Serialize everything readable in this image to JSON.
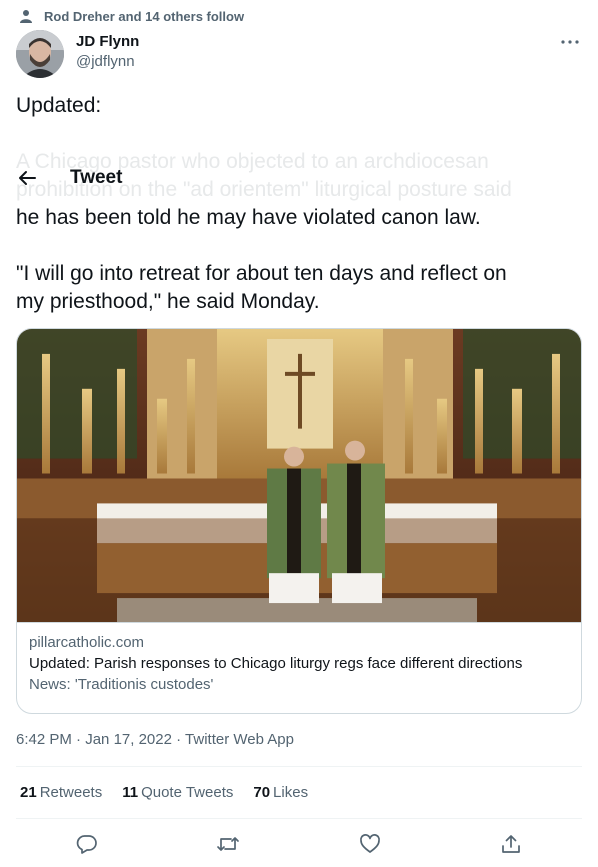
{
  "social_context": "Rod Dreher and 14 others follow",
  "header": {
    "title": "Tweet"
  },
  "author": {
    "name": "JD Flynn",
    "handle": "@jdflynn"
  },
  "tweet": {
    "line1": "Updated:",
    "ghost_line1": "A Chicago pastor who objected to an archdiocesan",
    "ghost_line2": "prohibition on the \"ad orientem\" liturgical posture said",
    "line2": "he has been told he may have violated canon law.",
    "line3": "\"I will go into retreat for about ten days and reflect on",
    "line4": "my priesthood,\" he said Monday."
  },
  "card": {
    "domain": "pillarcatholic.com",
    "title": "Updated: Parish responses to Chicago liturgy regs face different directions",
    "description": "News: 'Traditionis custodes'"
  },
  "meta": {
    "time": "6:42 PM",
    "date": "Jan 17, 2022",
    "source": "Twitter Web App",
    "sep": "·"
  },
  "stats": {
    "retweets_count": "21",
    "retweets_label": "Retweets",
    "quotes_count": "11",
    "quotes_label": "Quote Tweets",
    "likes_count": "70",
    "likes_label": "Likes"
  },
  "icons": [
    "person-icon",
    "more-icon",
    "back-arrow-icon",
    "reply-icon",
    "retweet-icon",
    "like-icon",
    "share-icon"
  ]
}
